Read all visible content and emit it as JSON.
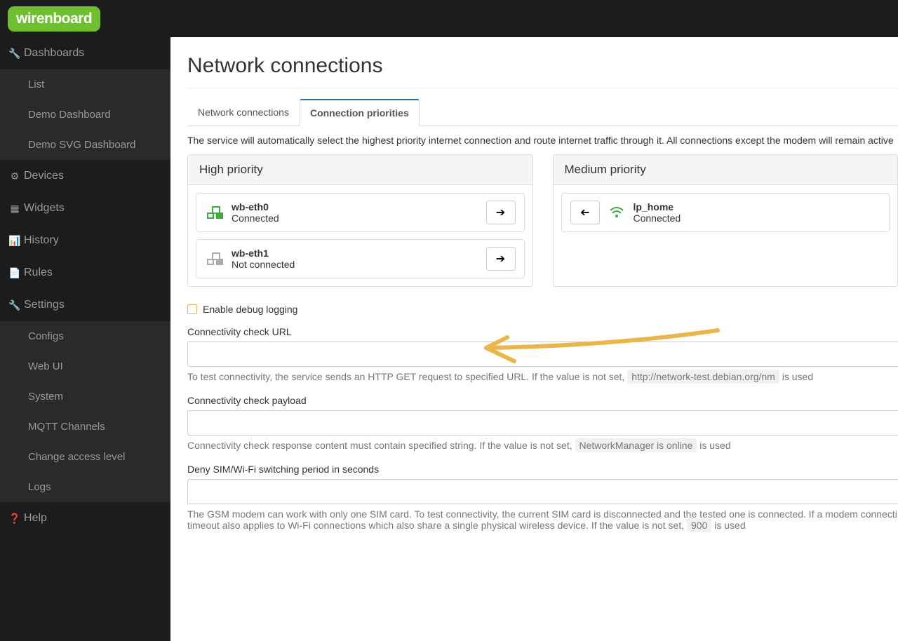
{
  "brand": "wirenboard",
  "sidebar": {
    "dashboards": {
      "label": "Dashboards",
      "items": [
        "List",
        "Demo Dashboard",
        "Demo SVG Dashboard"
      ]
    },
    "devices": "Devices",
    "widgets": "Widgets",
    "history": "History",
    "rules": "Rules",
    "settings": {
      "label": "Settings",
      "items": [
        "Configs",
        "Web UI",
        "System",
        "MQTT Channels",
        "Change access level",
        "Logs"
      ]
    },
    "help": "Help"
  },
  "page": {
    "title": "Network connections",
    "tabs": [
      "Network connections",
      "Connection priorities"
    ],
    "active_tab": 1,
    "description": "The service will automatically select the highest priority internet connection and route internet traffic through it. All connections except the modem will remain active"
  },
  "priority": {
    "high": {
      "title": "High priority",
      "items": [
        {
          "name": "wb-eth0",
          "status": "Connected",
          "type": "eth",
          "connected": true
        },
        {
          "name": "wb-eth1",
          "status": "Not connected",
          "type": "eth",
          "connected": false
        }
      ]
    },
    "medium": {
      "title": "Medium priority",
      "items": [
        {
          "name": "lp_home",
          "status": "Connected",
          "type": "wifi",
          "connected": true
        }
      ]
    }
  },
  "form": {
    "debug_label": "Enable debug logging",
    "url_label": "Connectivity check URL",
    "url_value": "",
    "url_help_pre": "To test connectivity, the service sends an HTTP GET request to specified URL. If the value is not set, ",
    "url_help_code": "http://network-test.debian.org/nm",
    "url_help_post": " is used",
    "payload_label": "Connectivity check payload",
    "payload_value": "",
    "payload_help_pre": "Connectivity check response content must contain specified string. If the value is not set, ",
    "payload_help_code": "NetworkManager is online",
    "payload_help_post": " is used",
    "deny_label": "Deny SIM/Wi-Fi switching period in seconds",
    "deny_value": "",
    "deny_help_pre": "The GSM modem can work with only one SIM card. To test connectivity, the current SIM card is disconnected and the tested one is connected. If a modem connecti",
    "deny_help_line2_pre": "timeout also applies to Wi-Fi connections which also share a single physical wireless device. If the value is not set, ",
    "deny_help_code": "900",
    "deny_help_post": " is used"
  }
}
